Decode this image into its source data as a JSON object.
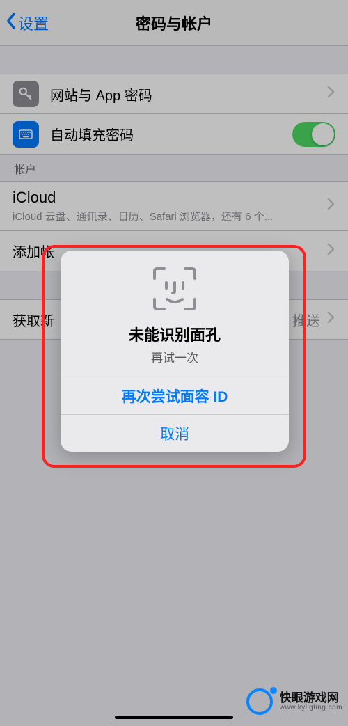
{
  "nav": {
    "back_label": "设置",
    "title": "密码与帐户"
  },
  "rows": {
    "passwords": "网站与 App 密码",
    "autofill": "自动填充密码"
  },
  "accounts_header": "帐户",
  "icloud": {
    "title": "iCloud",
    "sub": "iCloud 云盘、通讯录、日历、Safari 浏览器，还有 6 个..."
  },
  "add_account": "添加帐",
  "fetch": {
    "label": "获取新",
    "value": "推送"
  },
  "popup": {
    "title": "未能识别面孔",
    "sub": "再试一次",
    "retry": "再次尝试面容 ID",
    "cancel": "取消"
  },
  "watermark": {
    "line1": "快眼游戏网",
    "line2": "www.kyligting.com"
  }
}
